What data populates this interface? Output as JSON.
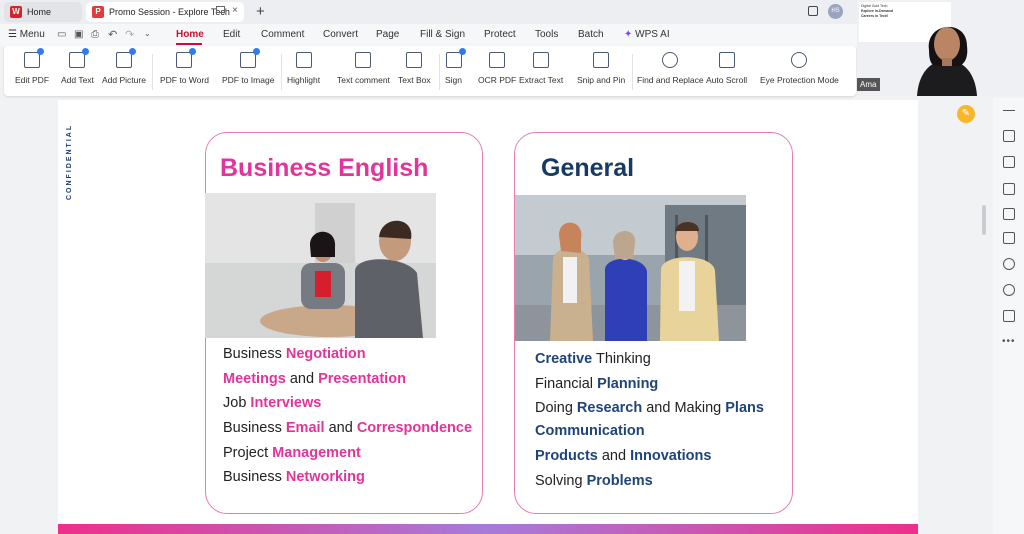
{
  "titlebar": {
    "tabs": [
      {
        "label": "Home",
        "icon": "wps-logo-icon"
      },
      {
        "label": "Promo Session - Explore Tech",
        "icon": "pdf-icon"
      }
    ],
    "avatar_initials": "HS"
  },
  "menubar": {
    "menu_label": "Menu",
    "items": [
      "Home",
      "Edit",
      "Comment",
      "Convert",
      "Page",
      "Fill & Sign",
      "Protect",
      "Tools",
      "Batch",
      "WPS AI"
    ],
    "active": "Home"
  },
  "toolbar": {
    "tools": [
      "Edit PDF",
      "Add Text",
      "Add Picture",
      "PDF to Word",
      "PDF to Image",
      "Highlight",
      "Text comment",
      "Text Box",
      "Sign",
      "OCR PDF",
      "Extract Text",
      "Snip and Pin",
      "Find and Replace",
      "Auto Scroll",
      "Eye Protection Mode"
    ]
  },
  "webcam": {
    "name": "Ama",
    "slide_lines": [
      "Digital Gold Tech",
      "Explore In-Demand",
      "Careers in Tech!"
    ]
  },
  "document": {
    "confidential": "CONFIDENTIAL",
    "left_card": {
      "title": "Business English",
      "lines": [
        {
          "plain": "Business ",
          "highlight": "Negotiation"
        },
        {
          "highlight": "Meetings",
          "plain": " and ",
          "highlight2": "Presentation"
        },
        {
          "plain": "Job ",
          "highlight": "Interviews"
        },
        {
          "plain": "Business ",
          "highlight": "Email",
          "plain2": " and ",
          "highlight2": "Correspondence"
        },
        {
          "plain": "Project ",
          "highlight": "Management"
        },
        {
          "plain": "Business ",
          "highlight": "Networking"
        }
      ]
    },
    "right_card": {
      "title": "General",
      "lines": [
        {
          "highlight": "Creative",
          "plain": " Thinking"
        },
        {
          "plain": "Financial ",
          "highlight": "Planning"
        },
        {
          "plain": "Doing ",
          "highlight": "Research",
          "plain2": " and Making ",
          "highlight2": "Plans"
        },
        {
          "highlight": "Communication"
        },
        {
          "highlight": "Products",
          "plain": " and ",
          "highlight2": "Innovations"
        },
        {
          "plain": "Solving ",
          "highlight": "Problems"
        }
      ]
    }
  },
  "colors": {
    "accent_pink": "#e2349a",
    "accent_navy": "#1f4478",
    "active_tab": "#c8102e"
  }
}
